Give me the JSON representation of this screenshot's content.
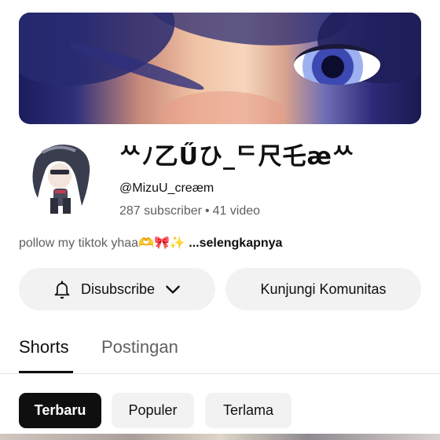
{
  "channel": {
    "name": "ᄊﾉ乙Űひ_ᄃ尺乇æᄊ",
    "handle": "@MizuU_creæm",
    "subscribers": "287 subscriber",
    "separator": "•",
    "videos": "41 video",
    "description": "pollow my tiktok yhaa🫶🎀✨",
    "description_more": "...selengkapnya"
  },
  "actions": {
    "subscribe_label": "Disubscribe",
    "community_label": "Kunjungi Komunitas"
  },
  "tabs": [
    {
      "label": "Shorts",
      "selected": true
    },
    {
      "label": "Postingan",
      "selected": false
    }
  ],
  "filters": [
    {
      "label": "Terbaru",
      "selected": true
    },
    {
      "label": "Populer",
      "selected": false
    },
    {
      "label": "Terlama",
      "selected": false
    }
  ],
  "icons": {
    "bell": "bell-icon",
    "chevron": "chevron-down-icon"
  },
  "colors": {
    "text_primary": "#0f0f0f",
    "text_secondary": "#606060",
    "chip_bg": "#f2f2f2",
    "chip_active_bg": "#0f0f0f"
  }
}
